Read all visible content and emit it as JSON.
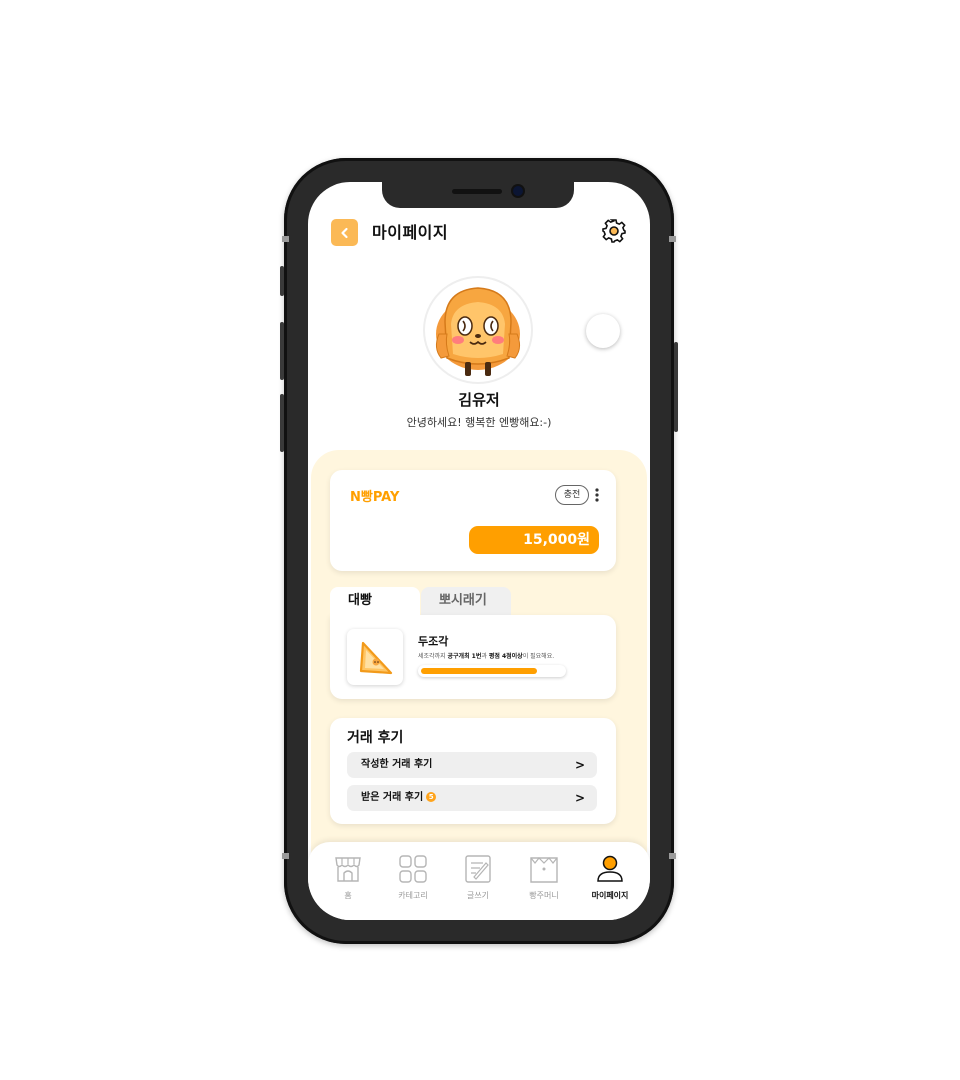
{
  "header": {
    "title": "마이페이지"
  },
  "profile": {
    "name": "김유저",
    "greeting": "안녕하세요! 행복한 엔빵해요:-)"
  },
  "pay": {
    "logo": "N빵PAY",
    "charge_label": "충전",
    "balance": "15,000원"
  },
  "tabs": [
    {
      "label": "대빵"
    },
    {
      "label": "뽀시래기"
    }
  ],
  "badge": {
    "title": "두조각",
    "desc_prefix": "세조각까지 ",
    "desc_bold1": "공구개최 1번",
    "desc_mid": "과 ",
    "desc_bold2": "평점 4점이상",
    "desc_suffix": "이 필요해요.",
    "progress": 0.82
  },
  "reviews": {
    "title": "거래 후기",
    "written_label": "작성한 거래 후기",
    "received_label": "받은 거래 후기",
    "received_count": "5",
    "chevron": ">"
  },
  "tabbar": {
    "items": [
      {
        "label": "홈",
        "icon": "store-icon"
      },
      {
        "label": "카테고리",
        "icon": "grid-icon"
      },
      {
        "label": "글쓰기",
        "icon": "write-icon"
      },
      {
        "label": "빵주머니",
        "icon": "bag-icon"
      },
      {
        "label": "마이페이지",
        "icon": "person-icon",
        "active": true
      }
    ]
  },
  "colors": {
    "accent": "#ff9f00",
    "back_button": "#fbb956",
    "cream": "#fff6de",
    "row": "#efefef"
  }
}
